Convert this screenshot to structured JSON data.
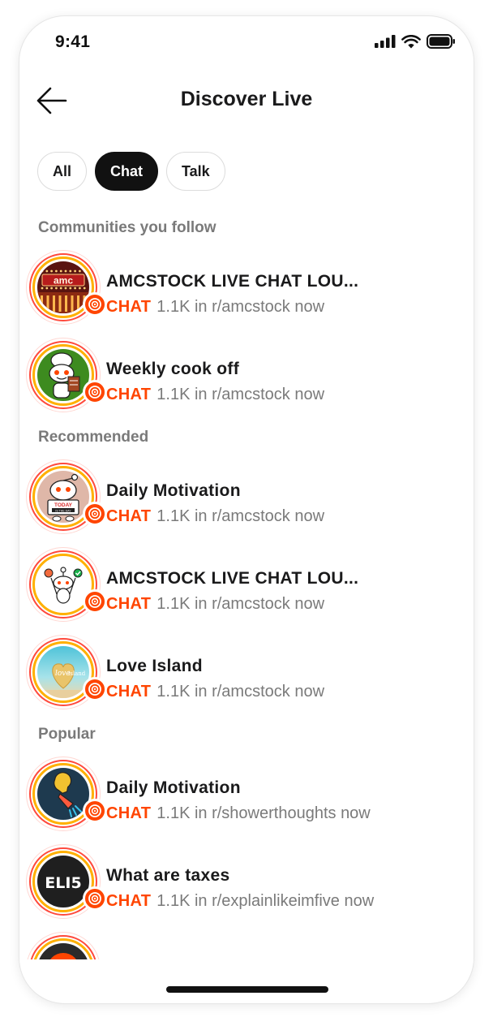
{
  "status": {
    "time": "9:41"
  },
  "header": {
    "title": "Discover Live",
    "back_icon": "arrow-left-icon"
  },
  "filters": [
    {
      "label": "All",
      "active": false
    },
    {
      "label": "Chat",
      "active": true
    },
    {
      "label": "Talk",
      "active": false
    }
  ],
  "sections": [
    {
      "title": "Communities you follow",
      "items": [
        {
          "title": "AMCSTOCK LIVE CHAT LOU...",
          "tag": "CHAT",
          "meta": "1.1K in r/amcstock now",
          "avatar": "amc-theater-avatar"
        },
        {
          "title": "Weekly cook off",
          "tag": "CHAT",
          "meta": "1.1K in r/amcstock now",
          "avatar": "chef-snoo-avatar"
        }
      ]
    },
    {
      "title": "Recommended",
      "items": [
        {
          "title": "Daily Motivation",
          "tag": "CHAT",
          "meta": "1.1K in r/amcstock now",
          "avatar": "snoo-sign-avatar"
        },
        {
          "title": "AMCSTOCK LIVE CHAT LOU...",
          "tag": "CHAT",
          "meta": "1.1K in r/amcstock now",
          "avatar": "snoo-juggle-avatar"
        },
        {
          "title": "Love Island",
          "tag": "CHAT",
          "meta": "1.1K in r/amcstock now",
          "avatar": "love-island-avatar"
        }
      ]
    },
    {
      "title": "Popular",
      "items": [
        {
          "title": "Daily Motivation",
          "tag": "CHAT",
          "meta": "1.1K in r/showerthoughts now",
          "avatar": "shower-bulb-avatar"
        },
        {
          "title": "What are taxes",
          "tag": "CHAT",
          "meta": "1.1K in r/explainlikeimfive now",
          "avatar": "eli5-avatar"
        },
        {
          "title": "",
          "tag": "",
          "meta": "",
          "avatar": "partial-avatar"
        }
      ]
    }
  ],
  "colors": {
    "accent": "#ff4500",
    "ring_red": "#ff4a3d",
    "ring_orange": "#ffb000",
    "chip_active": "#111111"
  }
}
